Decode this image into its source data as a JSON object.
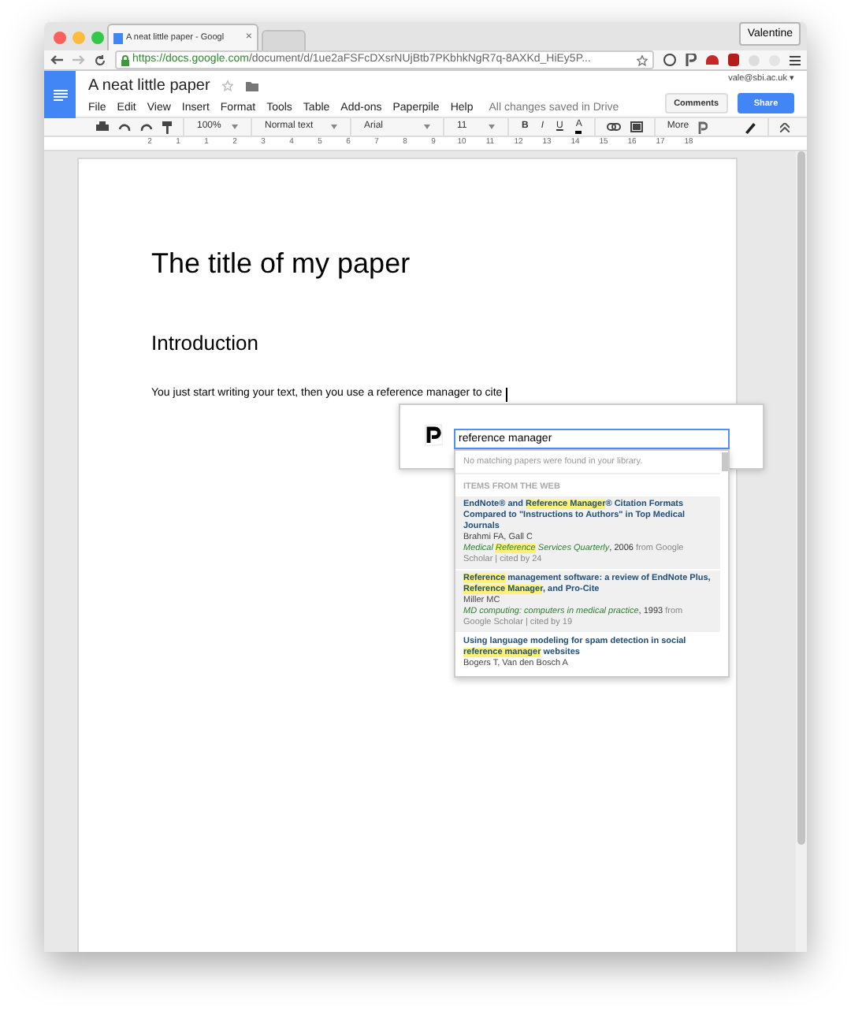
{
  "browser": {
    "tabs": [
      {
        "title": "A neat little paper - Googl",
        "selected": true,
        "close": "×"
      },
      {
        "selected": false
      }
    ],
    "profile": "Valentine",
    "url_host": "https://docs.google.com",
    "url_path": "/document/d/1ue2aFSFcDXsrNUjBtb7PKbhkNgR7q-8AXKd_HiEy5P..."
  },
  "doc": {
    "title": "A neat little paper",
    "account": "vale@sbi.ac.uk ▾",
    "menu": [
      "File",
      "Edit",
      "View",
      "Insert",
      "Format",
      "Tools",
      "Table",
      "Add-ons",
      "Paperpile",
      "Help"
    ],
    "save_status": "All changes saved in Drive",
    "comments_button": "Comments",
    "share_button": "Share"
  },
  "toolbar": {
    "zoom": "100%",
    "style": "Normal text",
    "font": "Arial",
    "size": "11",
    "bold": "B",
    "italic": "I",
    "underline": "U",
    "text_color_label": "A",
    "more": "More"
  },
  "ruler": [
    "2",
    "1",
    "1",
    "2",
    "3",
    "4",
    "5",
    "6",
    "7",
    "8",
    "9",
    "10",
    "11",
    "12",
    "13",
    "14",
    "15",
    "16",
    "17",
    "18"
  ],
  "page": {
    "title": "The title of my paper",
    "heading": "Introduction",
    "body": "You just start writing your text, then you use a reference manager to cite"
  },
  "citation_popup": {
    "query": "reference manager",
    "no_match": "No matching papers were found in your library.",
    "section": "ITEMS FROM THE WEB",
    "results": [
      {
        "shaded": true,
        "title": [
          {
            "text": "EndNote® and ",
            "hl": false
          },
          {
            "text": "Reference Manager",
            "hl": true
          },
          {
            "text": "® Citation Formats Compared to \"Instructions to Authors\" in Top Medical Journals",
            "hl": false
          }
        ],
        "authors": "Brahmi FA, Gall C",
        "journal": [
          {
            "text": "Medical ",
            "hl": false
          },
          {
            "text": "Reference",
            "hl": true
          },
          {
            "text": " Services Quarterly",
            "hl": false
          }
        ],
        "year": ", 2006",
        "details": "from Google Scholar | cited by 24"
      },
      {
        "shaded": true,
        "title": [
          {
            "text": "Reference",
            "hl": true
          },
          {
            "text": " management software: a review of EndNote Plus, ",
            "hl": false
          },
          {
            "text": "Reference Manager",
            "hl": true
          },
          {
            "text": ", and Pro-Cite",
            "hl": false
          }
        ],
        "authors": "Miller MC",
        "journal": [
          {
            "text": "MD computing: computers in medical practice",
            "hl": false
          }
        ],
        "year": ", 1993",
        "details": "from Google Scholar | cited by 19"
      },
      {
        "shaded": false,
        "title": [
          {
            "text": "Using language modeling for spam detection in social ",
            "hl": false
          },
          {
            "text": "reference manager",
            "hl": true
          },
          {
            "text": " websites",
            "hl": false
          }
        ],
        "authors": "Bogers T, Van den Bosch A"
      }
    ]
  }
}
